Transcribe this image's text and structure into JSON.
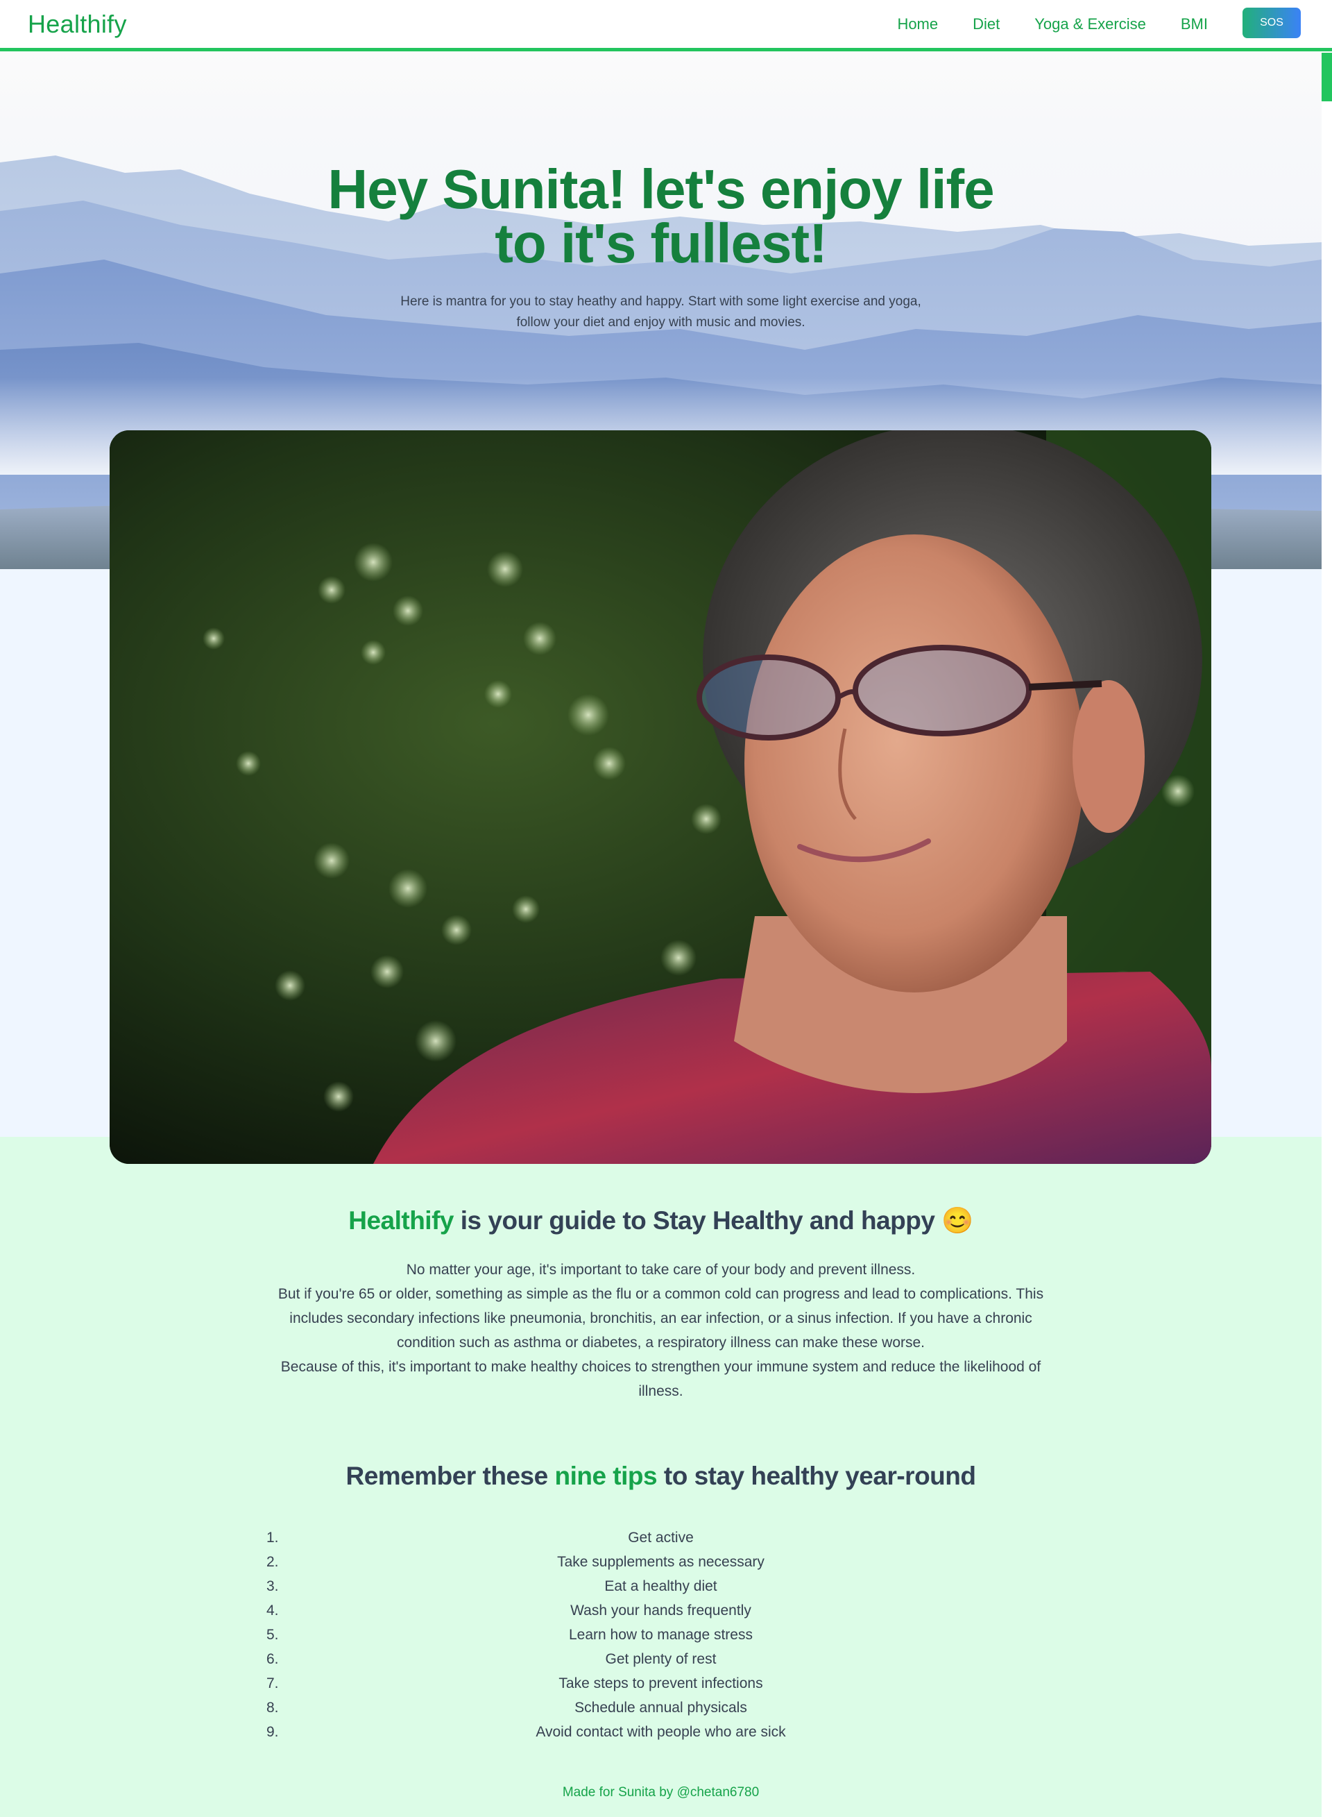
{
  "navbar": {
    "brand": "Healthify",
    "links": [
      "Home",
      "Diet",
      "Yoga & Exercise",
      "BMI"
    ],
    "sos_label": "SOS"
  },
  "hero": {
    "title_line1": "Hey Sunita! let's enjoy life",
    "title_line2": "to it's fullest!",
    "subtitle_line1": "Here is mantra for you to stay heathy and happy. Start with some light exercise and yoga,",
    "subtitle_line2": "follow your diet and enjoy with music and movies."
  },
  "guide": {
    "brand": "Healthify",
    "heading_rest": " is your guide to Stay Healthy and happy",
    "emoji": "😊",
    "paragraph_1": "No matter your age, it's important to take care of your body and prevent illness.",
    "paragraph_2": "But if you're 65 or older, something as simple as the flu or a common cold can progress and lead to complications. This includes secondary infections like pneumonia, bronchitis, an ear infection, or a sinus infection. If you have a chronic condition such as asthma or diabetes, a respiratory illness can make these worse.",
    "paragraph_3": "Because of this, it's important to make healthy choices to strengthen your immune system and reduce the likelihood of illness."
  },
  "tips": {
    "heading_pre": "Remember these ",
    "heading_highlight": "nine tips",
    "heading_post": " to stay healthy year-round",
    "items": [
      "Get active",
      "Take supplements as necessary",
      "Eat a healthy diet",
      "Wash your hands frequently",
      "Learn how to manage stress",
      "Get plenty of rest",
      "Take steps to prevent infections",
      "Schedule annual physicals",
      "Avoid contact with people who are sick"
    ]
  },
  "footer": {
    "text": "Made for Sunita by @chetan6780"
  },
  "colors": {
    "accent": "#16a34a",
    "bar": "#22c55e",
    "pale_green": "#dcfce7",
    "pale_blue": "#eff6ff"
  }
}
